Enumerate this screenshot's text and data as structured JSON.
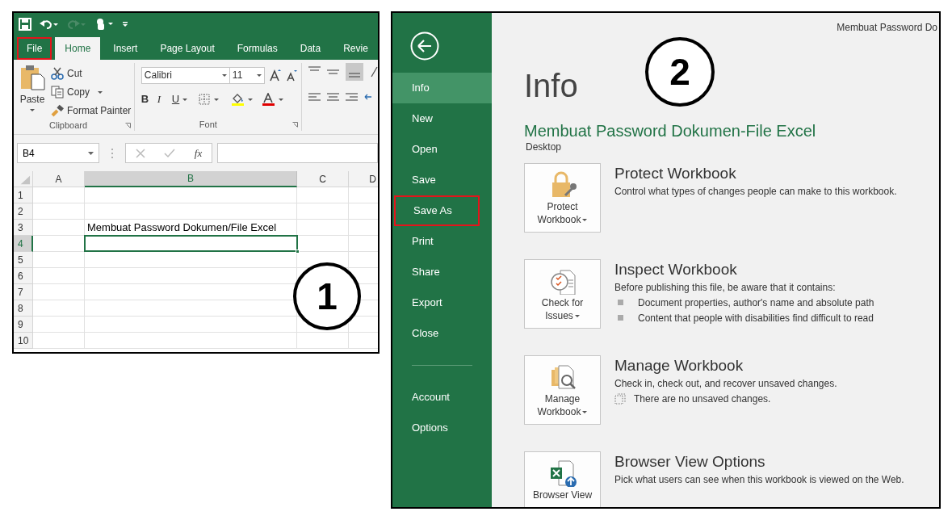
{
  "excel_window": {
    "tabs": [
      {
        "label": "File",
        "selected": false,
        "highlighted": true
      },
      {
        "label": "Home",
        "selected": true,
        "highlighted": false
      },
      {
        "label": "Insert",
        "selected": false,
        "highlighted": false
      },
      {
        "label": "Page Layout",
        "selected": false,
        "highlighted": false
      },
      {
        "label": "Formulas",
        "selected": false,
        "highlighted": false
      },
      {
        "label": "Data",
        "selected": false,
        "highlighted": false
      },
      {
        "label": "Revie",
        "selected": false,
        "highlighted": false
      }
    ],
    "clipboard": {
      "paste": "Paste",
      "commands": [
        "Cut",
        "Copy",
        "Format Painter"
      ],
      "group_label": "Clipboard"
    },
    "font": {
      "font_name": "Calibri",
      "font_size": "11",
      "bold": "B",
      "italic": "I",
      "underline": "U",
      "group_label": "Font"
    },
    "name_box": "B4",
    "function_label": "fx",
    "grid": {
      "columns": [
        {
          "label": "A",
          "selected": false
        },
        {
          "label": "B",
          "selected": true
        },
        {
          "label": "C",
          "selected": false
        },
        {
          "label": "D",
          "selected": false
        }
      ],
      "rows": [
        {
          "label": "1",
          "selected": false
        },
        {
          "label": "2",
          "selected": false
        },
        {
          "label": "3",
          "selected": false,
          "cells": [
            {
              "kind": "empty"
            },
            {
              "kind": "text",
              "text": "Membuat Password Dokumen/File Excel"
            }
          ]
        },
        {
          "label": "4",
          "selected": true
        },
        {
          "label": "5",
          "selected": false
        },
        {
          "label": "6",
          "selected": false
        },
        {
          "label": "7",
          "selected": false
        },
        {
          "label": "8",
          "selected": false
        },
        {
          "label": "9",
          "selected": false
        },
        {
          "label": "10",
          "selected": false
        }
      ]
    },
    "step": "1"
  },
  "backstage": {
    "window_title": "Membuat Password Do",
    "menu": [
      {
        "label": "Info",
        "selected": true,
        "highlighted": false
      },
      {
        "label": "New",
        "selected": false,
        "highlighted": false
      },
      {
        "label": "Open",
        "selected": false,
        "highlighted": false
      },
      {
        "label": "Save",
        "selected": false,
        "highlighted": false
      },
      {
        "label": "Save As",
        "selected": false,
        "highlighted": true
      },
      {
        "label": "Print",
        "selected": false,
        "highlighted": false
      },
      {
        "label": "Share",
        "selected": false,
        "highlighted": false
      },
      {
        "label": "Export",
        "selected": false,
        "highlighted": false
      },
      {
        "label": "Close",
        "selected": false,
        "highlighted": false
      }
    ],
    "bottom_menu": [
      {
        "label": "Account",
        "selected": false,
        "highlighted": false
      },
      {
        "label": "Options",
        "selected": false,
        "highlighted": false
      }
    ],
    "heading": "Info",
    "document_title": "Membuat Password Dokumen-File Excel",
    "location": "Desktop",
    "sections": [
      {
        "kind": "protect",
        "button": "Protect Workbook",
        "dropdown": true,
        "title": "Protect Workbook",
        "description": "Control what types of changes people can make to this workbook."
      },
      {
        "kind": "inspect",
        "button": "Check for Issues",
        "dropdown": true,
        "title": "Inspect Workbook",
        "description": "Before publishing this file, be aware that it contains:",
        "bullets": [
          "Document properties, author's name and absolute path",
          "Content that people with disabilities find difficult to read"
        ]
      },
      {
        "kind": "manage",
        "button": "Manage Workbook",
        "dropdown": true,
        "title": "Manage Workbook",
        "description": "Check in, check out, and recover unsaved changes.",
        "note": "There are no unsaved changes."
      },
      {
        "kind": "browser",
        "button": "Browser View",
        "dropdown": false,
        "title": "Browser View Options",
        "description": "Pick what users can see when this workbook is viewed on the Web."
      }
    ],
    "step": "2"
  }
}
